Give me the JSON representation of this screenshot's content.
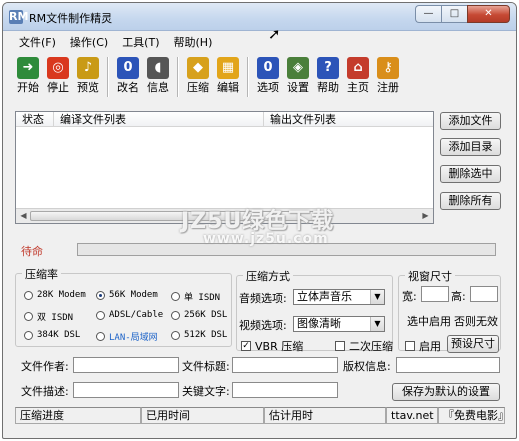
{
  "window": {
    "title": "RM文件制作精灵",
    "app_icon": "RM"
  },
  "window_buttons": {
    "minimize": "—",
    "maximize": "□",
    "close": "✕"
  },
  "menu": [
    "文件(F)",
    "操作(C)",
    "工具(T)",
    "帮助(H)"
  ],
  "toolbar": [
    {
      "label": "开始",
      "icon": "play-icon",
      "glyph": "➜",
      "color": "#2e8b3a"
    },
    {
      "label": "停止",
      "icon": "stop-icon",
      "glyph": "◎",
      "color": "#d9381e"
    },
    {
      "label": "预览",
      "icon": "music-note-icon",
      "glyph": "♪",
      "color": "#c99a16"
    },
    {
      "label": "改名",
      "icon": "rename-icon",
      "glyph": "0",
      "color": "#2c54b8"
    },
    {
      "label": "信息",
      "icon": "info-icon",
      "glyph": "◖",
      "color": "#555555"
    },
    {
      "label": "压缩",
      "icon": "compress-icon",
      "glyph": "◆",
      "color": "#d7a11c"
    },
    {
      "label": "编辑",
      "icon": "film-edit-icon",
      "glyph": "▦",
      "color": "#e2a51a"
    },
    {
      "label": "选项",
      "icon": "options-icon",
      "glyph": "0",
      "color": "#2c54b8"
    },
    {
      "label": "设置",
      "icon": "settings-icon",
      "glyph": "◈",
      "color": "#4a7f3a"
    },
    {
      "label": "帮助",
      "icon": "help-icon",
      "glyph": "?",
      "color": "#2c54b8"
    },
    {
      "label": "主页",
      "icon": "home-icon",
      "glyph": "⌂",
      "color": "#c43c2c"
    },
    {
      "label": "注册",
      "icon": "key-icon",
      "glyph": "⚷",
      "color": "#d98e1a"
    }
  ],
  "list": {
    "columns": [
      "状态",
      "编译文件列表",
      "输出文件列表"
    ]
  },
  "side_buttons": [
    "添加文件",
    "添加目录",
    "删除选中",
    "删除所有"
  ],
  "status": {
    "label": "待命"
  },
  "compression_rate": {
    "title": "压缩率",
    "options": [
      {
        "label": "28K Modem",
        "selected": false
      },
      {
        "label": "56K Modem",
        "selected": true
      },
      {
        "label": "单 ISDN",
        "selected": false
      },
      {
        "label": "双 ISDN",
        "selected": false
      },
      {
        "label": "ADSL/Cable",
        "selected": false
      },
      {
        "label": "256K DSL",
        "selected": false
      },
      {
        "label": "384K DSL",
        "selected": false
      },
      {
        "label": "LAN-局域网",
        "selected": false
      },
      {
        "label": "512K DSL",
        "selected": false
      }
    ]
  },
  "compression_method": {
    "title": "压缩方式",
    "audio_label": "音频选项:",
    "audio_value": "立体声音乐",
    "video_label": "视频选项:",
    "video_value": "图像清晰",
    "vbr_label": "VBR 压缩",
    "vbr_checked": true,
    "two_pass_label": "二次压缩",
    "two_pass_checked": false
  },
  "window_size": {
    "title": "视窗尺寸",
    "width_label": "宽:",
    "height_label": "高:",
    "enable_label": "选中启用",
    "disable_label": "否则无效",
    "enable_check_label": "启用",
    "enable_checked": false,
    "preset_button": "预设尺寸"
  },
  "meta_fields": {
    "author_label": "文件作者:",
    "title_label": "文件标题:",
    "copyright_label": "版权信息:",
    "description_label": "文件描述:",
    "keywords_label": "关键文字:",
    "save_default_button": "保存为默认的设置"
  },
  "statusbar": [
    "压缩进度",
    "已用时间",
    "估计用时",
    "ttav.net",
    "『免费电影』"
  ],
  "watermark": {
    "line1": "JZ5U绿色下载",
    "line2": "www.jz5u.com"
  }
}
